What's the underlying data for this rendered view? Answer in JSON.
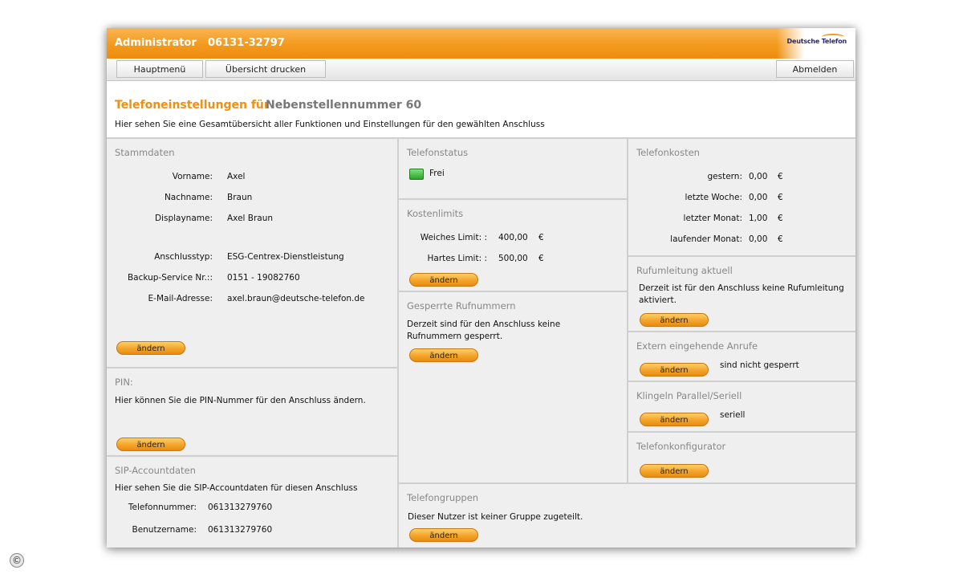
{
  "header": {
    "title": "Administrator",
    "phone": "06131-32797",
    "logo": "Deutsche Telefon"
  },
  "nav": {
    "main_menu": "Hauptmenü",
    "print_overview": "Übersicht drucken",
    "logout": "Abmelden"
  },
  "page": {
    "title_prefix": "Telefoneinstellungen für",
    "title_extension": "Nebenstellennummer 60",
    "description": "Hier sehen Sie eine Gesamtübersicht aller Funktionen und Einstellungen für den gewählten Anschluss"
  },
  "stammdaten": {
    "title": "Stammdaten",
    "rows": [
      {
        "label": "Vorname:",
        "value": "Axel"
      },
      {
        "label": "Nachname:",
        "value": "Braun"
      },
      {
        "label": "Displayname:",
        "value": "Axel Braun"
      },
      {
        "label": "Anschlusstyp:",
        "value": "ESG-Centrex-Dienstleistung"
      },
      {
        "label": "Backup-Service Nr.::",
        "value": "0151 - 19082760"
      },
      {
        "label": "E-Mail-Adresse:",
        "value": "axel.braun@deutsche-telefon.de"
      }
    ],
    "button": "ändern"
  },
  "pin": {
    "title": "PIN:",
    "text": "Hier können Sie die PIN-Nummer für den Anschluss ändern.",
    "button": "ändern"
  },
  "sip": {
    "title": "SIP-Accountdaten",
    "text": "Hier sehen Sie die SIP-Accountdaten für diesen Anschluss",
    "rows": [
      {
        "label": "Telefonnummer:",
        "value": "061313279760"
      },
      {
        "label": "Benutzername:",
        "value": "061313279760"
      }
    ]
  },
  "telefonstatus": {
    "title": "Telefonstatus",
    "status": "Frei",
    "status_color": "#2aa52a"
  },
  "kostenlimits": {
    "title": "Kostenlimits",
    "rows": [
      {
        "label": "Weiches Limit: :",
        "value": "400,00",
        "unit": "€"
      },
      {
        "label": "Hartes Limit: :",
        "value": "500,00",
        "unit": "€"
      }
    ],
    "button": "ändern"
  },
  "gesperrte": {
    "title": "Gesperrte Rufnummern",
    "text_line1": "Derzeit sind für den Anschluss keine",
    "text_line2": "Rufnummern gesperrt.",
    "button": "ändern"
  },
  "telefongruppen": {
    "title": "Telefongruppen",
    "text": "Dieser Nutzer ist keiner Gruppe zugeteilt.",
    "button": "ändern"
  },
  "telefonkosten": {
    "title": "Telefonkosten",
    "rows": [
      {
        "label": "gestern:",
        "value": "0,00",
        "unit": "€"
      },
      {
        "label": "letzte Woche:",
        "value": "0,00",
        "unit": "€"
      },
      {
        "label": "letzter Monat:",
        "value": "1,00",
        "unit": "€"
      },
      {
        "label": "laufender Monat:",
        "value": "0,00",
        "unit": "€"
      }
    ]
  },
  "rufumleitung": {
    "title": "Rufumleitung aktuell",
    "text_line1": "Derzeit ist für den Anschluss keine Rufumleitung",
    "text_line2": "aktiviert.",
    "button": "ändern"
  },
  "extern": {
    "title": "Extern eingehende Anrufe",
    "status": "sind nicht gesperrt",
    "button": "ändern"
  },
  "klingeln": {
    "title": "Klingeln Parallel/Seriell",
    "status": "seriell",
    "button": "ändern"
  },
  "konfigurator": {
    "title": "Telefonkonfigurator",
    "button": "ändern"
  },
  "colors": {
    "accent": "#f39a1c",
    "title_orange": "#ef8f13",
    "panel_bg": "#efefef",
    "panel_title": "#888888"
  }
}
